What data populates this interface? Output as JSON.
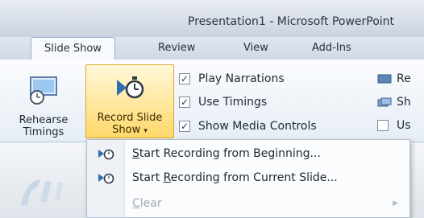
{
  "window": {
    "title": "Presentation1 - Microsoft PowerPoint"
  },
  "tabs": [
    "Slide Show",
    "Review",
    "View",
    "Add-Ins"
  ],
  "ribbon": {
    "rehearse": {
      "line1": "Rehearse",
      "line2": "Timings"
    },
    "record": {
      "line1": "Record Slide",
      "line2": "Show",
      "caret": "▾"
    },
    "checkboxes": [
      {
        "label": "Play Narrations",
        "checked": true
      },
      {
        "label": "Use Timings",
        "checked": true
      },
      {
        "label": "Show Media Controls",
        "checked": true
      }
    ],
    "side_items": [
      "Re",
      "Sh",
      "Us"
    ]
  },
  "menu": {
    "items": [
      {
        "pre": "",
        "u": "S",
        "post": "tart Recording from Beginning...",
        "enabled": true
      },
      {
        "pre": "Start ",
        "u": "R",
        "post": "ecording from Current Slide...",
        "enabled": true
      },
      {
        "pre": "",
        "u": "C",
        "post": "lear",
        "enabled": false,
        "arrow": "▶"
      }
    ]
  },
  "colors": {
    "highlight": "#ffd86a",
    "ribbon": "#e6edf5"
  }
}
